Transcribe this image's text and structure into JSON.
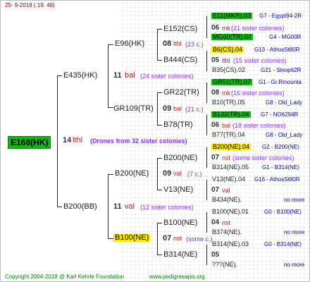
{
  "header": {
    "text": "25-  9-2018  (  19:  48)"
  },
  "footer": {
    "copyright": "Copyright 2004-2018 @ Karl Kehrle Foundation",
    "site": "www.pedigreeapis.org"
  },
  "root": {
    "id": "E168(HK)",
    "gen": "14",
    "marker": "lthl",
    "desc": "(Drones from 32 sister colonies)"
  },
  "gen2": [
    {
      "id": "E435(HK)",
      "gen": "11",
      "marker": "bal",
      "desc": "(24 sister colonies)"
    },
    {
      "id": "B200(BB)",
      "gen": "11",
      "marker": "val",
      "desc": "(12 sister colonies)"
    }
  ],
  "gen3": [
    {
      "id": "E96(HK)",
      "gen": "08",
      "marker": "lthl",
      "desc": "(23 c.)"
    },
    {
      "id": "GR109(TR)",
      "gen": "09",
      "marker": "bal",
      "desc": "(21 c.)"
    },
    {
      "id": "B200(NE)",
      "gen": "09",
      "marker": "val",
      "desc": "(7 c.)"
    },
    {
      "id": "B100(NE)",
      "gen": "07",
      "marker": "nst",
      "desc": "(some c.)"
    }
  ],
  "gen4": [
    {
      "id": "E152(CS)"
    },
    {
      "id": "B444(CS)"
    },
    {
      "id": "GR22(TR)"
    },
    {
      "id": "B78(TR)"
    },
    {
      "id": "B200(NE)"
    },
    {
      "id": "V13(NE)"
    },
    {
      "id": "B100(NE)"
    },
    {
      "id": "B314(NE)"
    }
  ],
  "gen4info": [
    {
      "gen": "06",
      "marker": "mk",
      "desc": "(21 sister colonies)"
    },
    {
      "gen": "05",
      "marker": "lthl",
      "desc": "(15 sister colonies)"
    },
    {
      "gen": "08",
      "marker": "mk",
      "desc": "(16 sister colonies)"
    },
    {
      "gen": "06",
      "marker": "bal",
      "desc": "(18 sister colonies)"
    },
    {
      "gen": "07",
      "marker": "nst",
      "desc": "(some sister colonies)"
    },
    {
      "gen": "07",
      "marker": "val",
      "desc": ""
    },
    {
      "gen": "04",
      "marker": "nst",
      "desc": ""
    },
    {
      "gen": "05",
      "marker": "",
      "desc": ""
    }
  ],
  "gen5": [
    {
      "id": "E11(MKR).03",
      "nav": "G7 - Egypt94-2R"
    },
    {
      "id": "MG60(TR).04",
      "nav": "G4 - MG00R"
    },
    {
      "id": "B6(CS).04",
      "nav": "G13 - AthosSt80R"
    },
    {
      "id": "B35(CS).02",
      "nav": "G21 - Sinop62R"
    },
    {
      "id": "GR51(TR).07",
      "nav": "G1 - Gr.Rmounta"
    },
    {
      "id": "B10(TR).05",
      "nav": "G8 - Old_Lady"
    },
    {
      "id": "B132(TR).04",
      "nav": "G7 - NO6294R"
    },
    {
      "id": "B77(TR).04",
      "nav": "G8 - Old_Lady"
    },
    {
      "id": "B200(NE).04",
      "nav": "G2 - B200(NE)"
    },
    {
      "id": "B314(NE).05",
      "nav": "G1 - B314(NE)"
    },
    {
      "id": "V13(NE).04",
      "nav": "G16 - AthosSt80R"
    },
    {
      "id": "B434(NE).",
      "nav": "no more"
    },
    {
      "id": "B100(NE).01",
      "nav": "G0 - B100(NE)"
    },
    {
      "id": "B374(NE).",
      "nav": "no more"
    },
    {
      "id": "B314(NE).03",
      "nav": "G0 - B314(NE)"
    },
    {
      "id": "???(NE).",
      "nav": "no more"
    }
  ]
}
